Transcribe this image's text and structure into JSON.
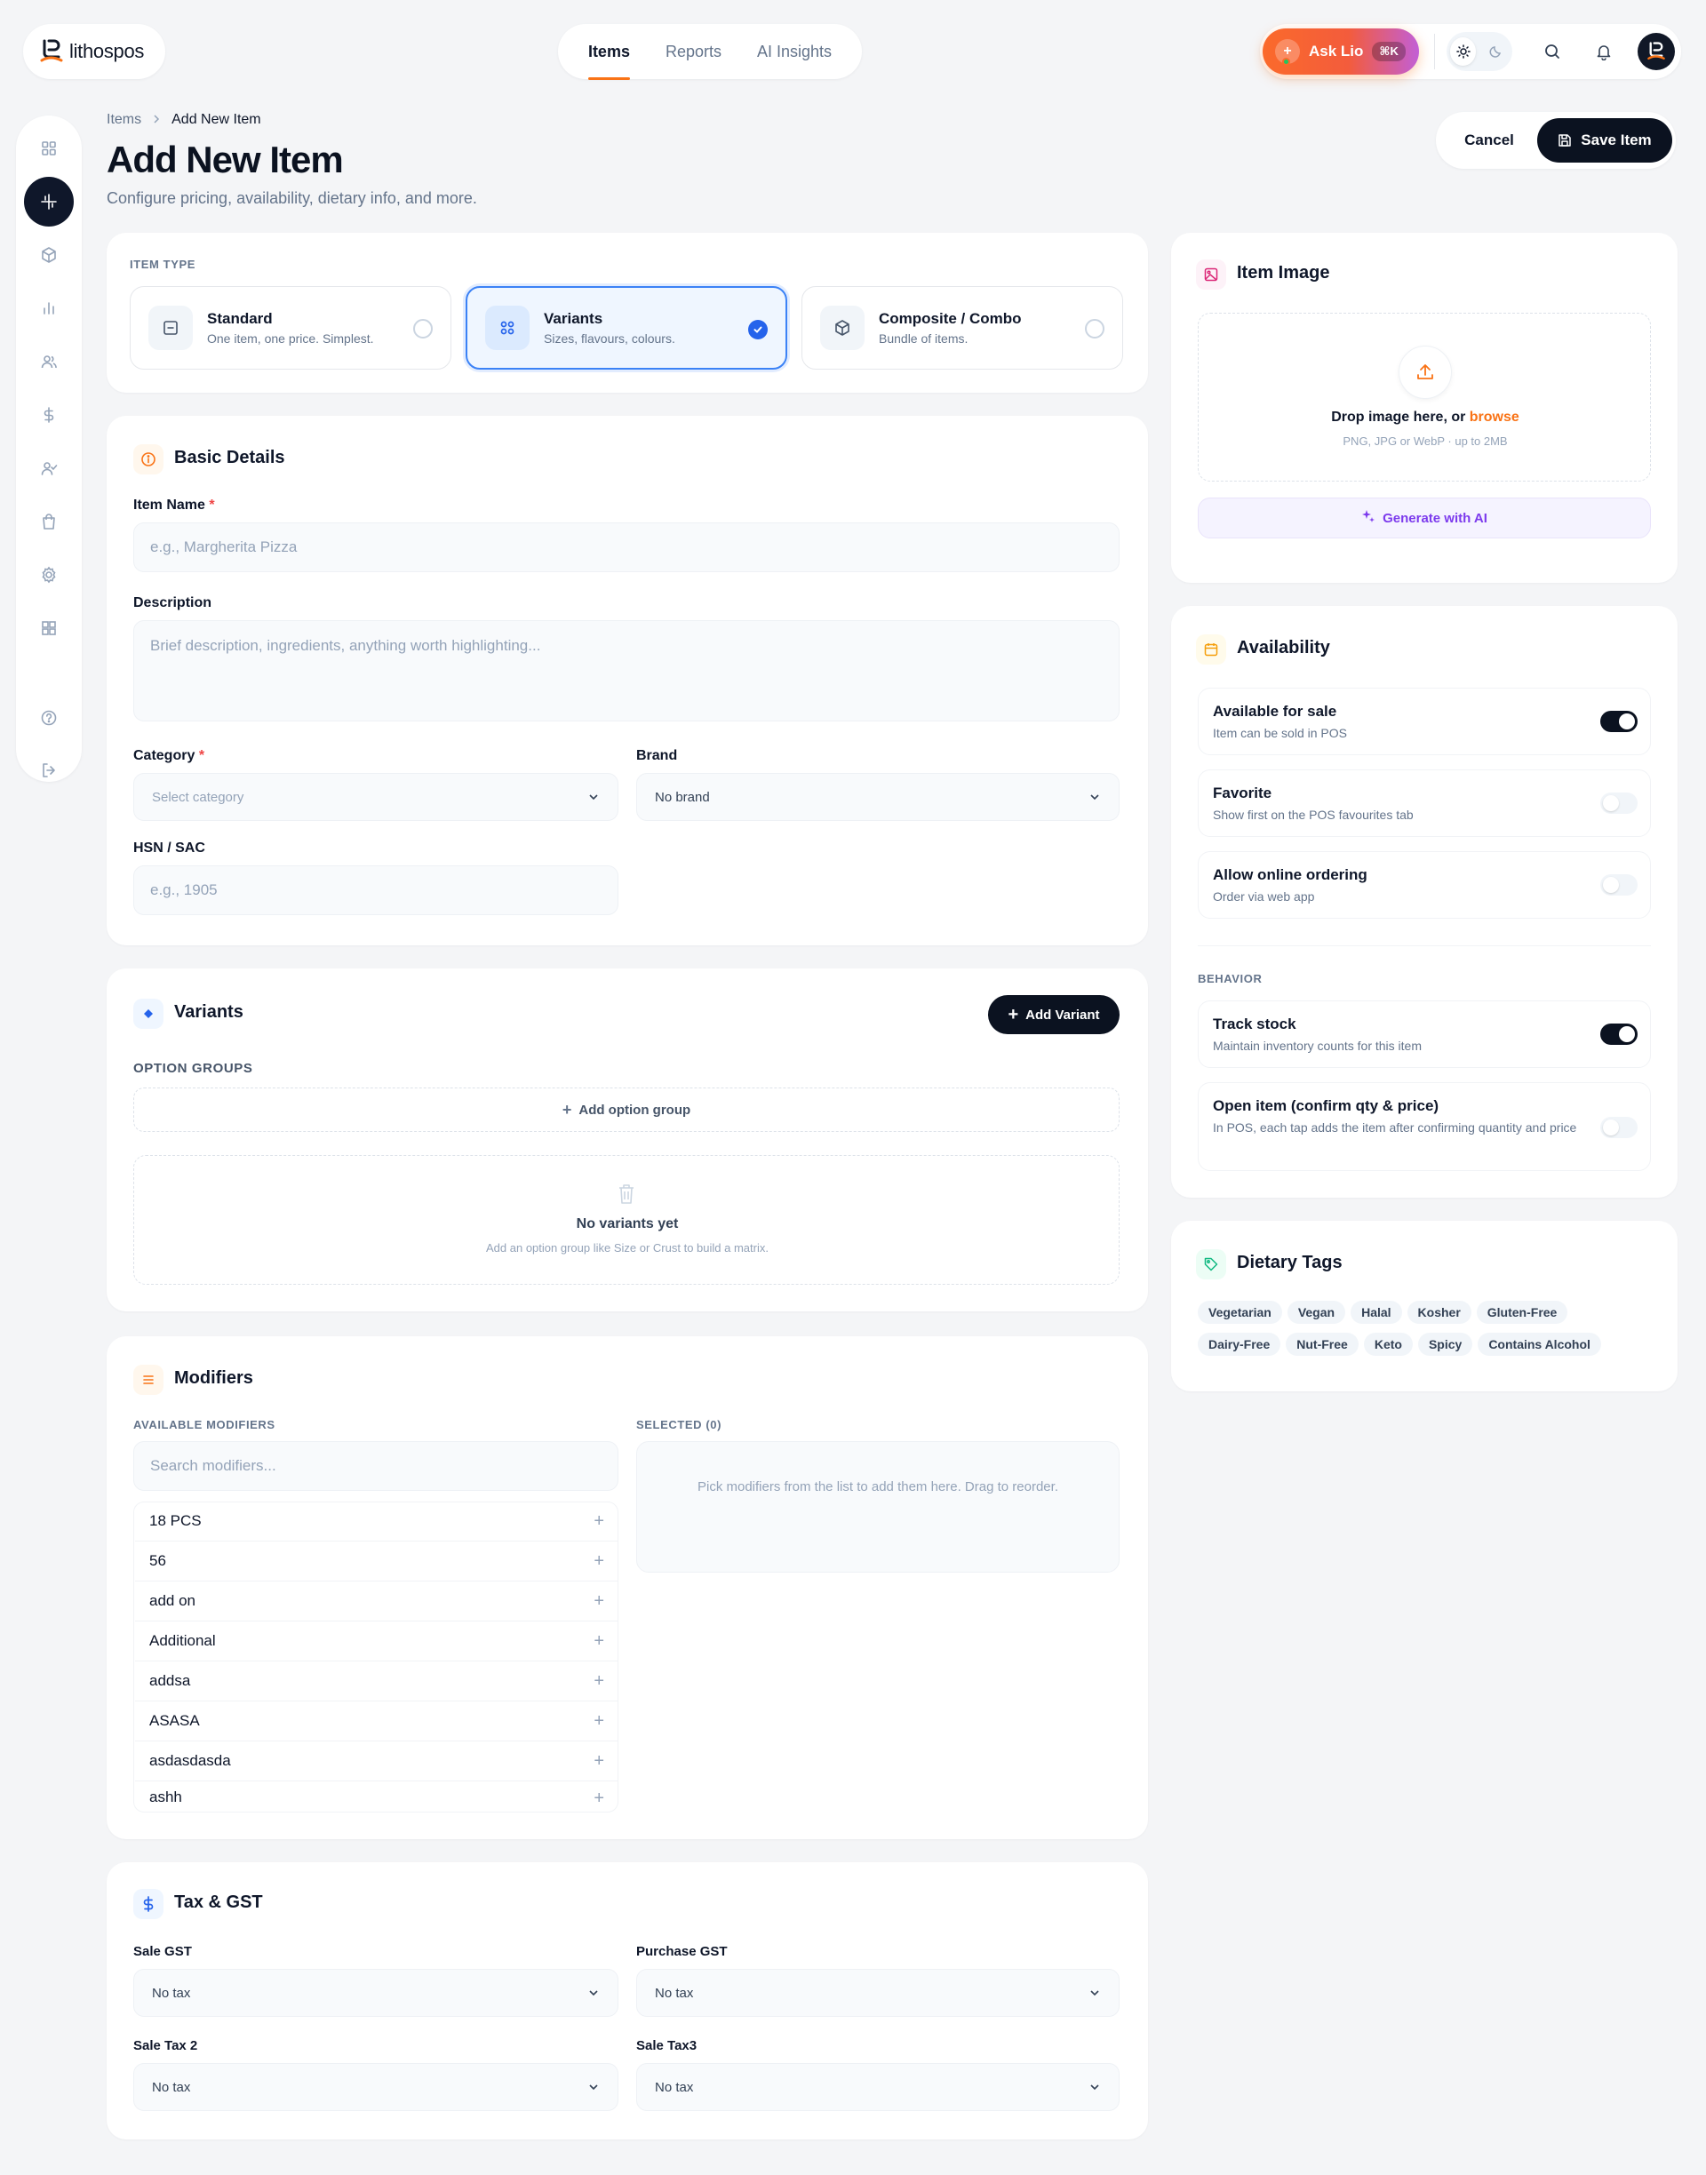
{
  "brand": {
    "name": "lithospos"
  },
  "nav": {
    "tabs": [
      {
        "label": "Items",
        "active": true
      },
      {
        "label": "Reports",
        "active": false
      },
      {
        "label": "AI Insights",
        "active": false
      }
    ]
  },
  "topbar": {
    "ask_label": "Ask Lio",
    "ask_shortcut": "⌘K"
  },
  "breadcrumb": {
    "parent": "Items",
    "current": "Add New Item"
  },
  "header": {
    "title": "Add New Item",
    "subtitle": "Configure pricing, availability, dietary info, and more.",
    "cancel_label": "Cancel",
    "save_label": "Save Item"
  },
  "item_type": {
    "label": "ITEM TYPE",
    "options": [
      {
        "name": "Standard",
        "desc": "One item, one price. Simplest.",
        "selected": false
      },
      {
        "name": "Variants",
        "desc": "Sizes, flavours, colours.",
        "selected": true
      },
      {
        "name": "Composite / Combo",
        "desc": "Bundle of items.",
        "selected": false
      }
    ]
  },
  "basic": {
    "title": "Basic Details",
    "name_label": "Item Name",
    "name_placeholder": "e.g., Margherita Pizza",
    "desc_label": "Description",
    "desc_placeholder": "Brief description, ingredients, anything worth highlighting...",
    "category_label": "Category",
    "category_value": "Select category",
    "brand_label": "Brand",
    "brand_value": "No brand",
    "hsn_label": "HSN / SAC",
    "hsn_placeholder": "e.g., 1905"
  },
  "variants": {
    "title": "Variants",
    "add_label": "Add Variant",
    "groups_label": "OPTION GROUPS",
    "add_group_label": "Add option group",
    "empty_title": "No variants yet",
    "empty_desc": "Add an option group like Size or Crust to build a matrix."
  },
  "modifiers": {
    "title": "Modifiers",
    "available_label": "AVAILABLE MODIFIERS",
    "selected_label": "SELECTED (0)",
    "search_placeholder": "Search modifiers...",
    "empty_selected": "Pick modifiers from the list to add them here. Drag to reorder.",
    "items": [
      "18 PCS",
      "56",
      "add on",
      "Additional",
      "addsa",
      "ASASA",
      "asdasdasda",
      "ashh"
    ]
  },
  "tax": {
    "title": "Tax & GST",
    "sale_gst_label": "Sale GST",
    "sale_gst_value": "No tax",
    "purchase_gst_label": "Purchase GST",
    "purchase_gst_value": "No tax",
    "sale_tax2_label": "Sale Tax 2",
    "sale_tax2_value": "No tax",
    "sale_tax3_label": "Sale Tax3",
    "sale_tax3_value": "No tax"
  },
  "image": {
    "title": "Item Image",
    "drop_text": "Drop image here, or ",
    "browse": "browse",
    "hint": "PNG, JPG or WebP · up to 2MB",
    "ai_label": "Generate with AI"
  },
  "availability": {
    "title": "Availability",
    "rows": [
      {
        "title": "Available for sale",
        "desc": "Item can be sold in POS",
        "on": true
      },
      {
        "title": "Favorite",
        "desc": "Show first on the POS favourites tab",
        "on": false
      },
      {
        "title": "Allow online ordering",
        "desc": "Order via web app",
        "on": false
      }
    ],
    "behavior_label": "BEHAVIOR",
    "behavior": [
      {
        "title": "Track stock",
        "desc": "Maintain inventory counts for this item",
        "on": true
      },
      {
        "title": "Open item (confirm qty & price)",
        "desc": "In POS, each tap adds the item after confirming quantity and price",
        "on": false
      }
    ]
  },
  "dietary": {
    "title": "Dietary Tags",
    "tags": [
      "Vegetarian",
      "Vegan",
      "Halal",
      "Kosher",
      "Gluten-Free",
      "Dairy-Free",
      "Nut-Free",
      "Keto",
      "Spicy",
      "Contains Alcohol"
    ]
  },
  "colors": {
    "accent": "#f97316",
    "primary_dark": "#0b1220",
    "selected_blue": "#2563eb"
  }
}
